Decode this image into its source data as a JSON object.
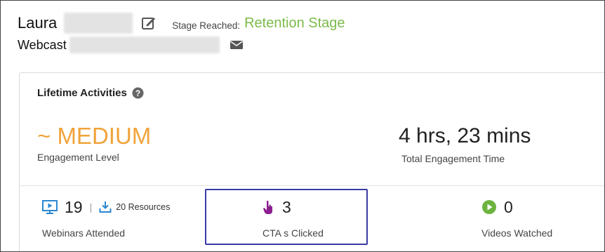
{
  "header": {
    "first_name": "Laura",
    "stage_label": "Stage Reached:",
    "stage_value": "Retention Stage",
    "sub_label": "Webcast"
  },
  "panel": {
    "title": "Lifetime Activities",
    "engagement": {
      "value": "~ MEDIUM",
      "label": "Engagement Level"
    },
    "total_time": {
      "value": "4 hrs, 23 mins",
      "label": "Total Engagement Time"
    }
  },
  "stats": {
    "webinars": {
      "count": "19",
      "separator": "|",
      "resources": "20 Resources",
      "label": "Webinars Attended"
    },
    "ctas": {
      "count": "3",
      "label": "CTA s Clicked"
    },
    "videos": {
      "count": "0",
      "label": "Videos Watched"
    }
  },
  "colors": {
    "stage_green": "#7cbb4a",
    "engagement_orange": "#f0a43b",
    "webinar_blue": "#2b87d1",
    "cta_purple": "#8b1f8f",
    "video_green": "#6db33f",
    "highlight_border": "#3b3ba8"
  },
  "icons": {
    "edit": "edit-icon",
    "mail": "mail-icon",
    "help": "help-icon",
    "webinar": "monitor-play-icon",
    "resources": "download-icon",
    "cta": "pointer-click-icon",
    "video": "play-circle-icon"
  }
}
